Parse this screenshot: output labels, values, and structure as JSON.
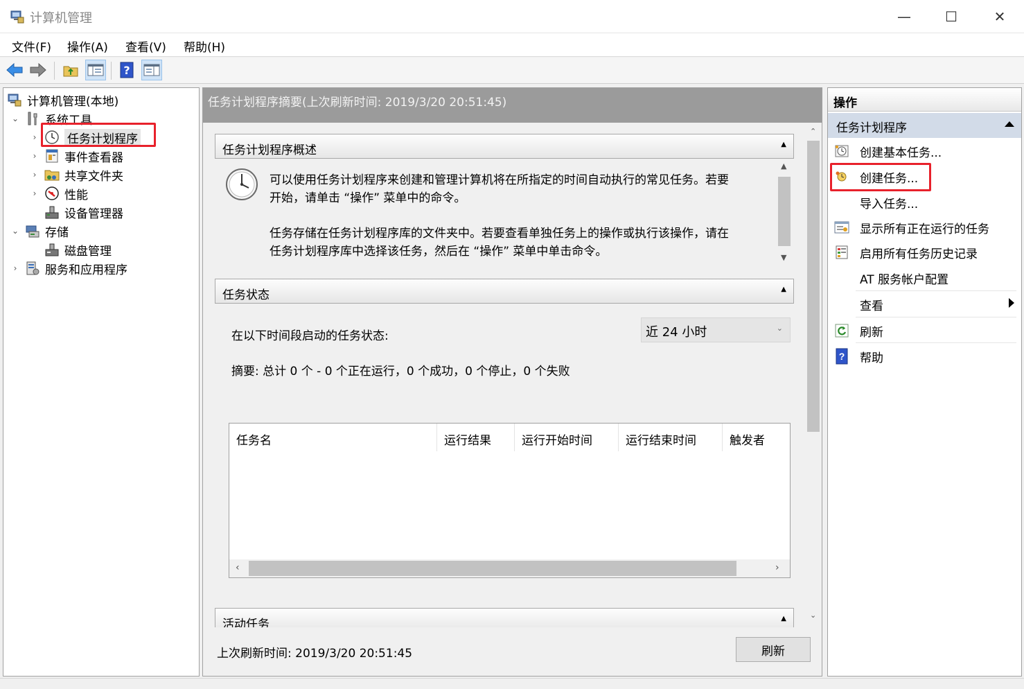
{
  "window": {
    "title": "计算机管理",
    "minimize_glyph": "—",
    "maximize_glyph": "☐",
    "close_glyph": "✕"
  },
  "menu": [
    "文件(F)",
    "操作(A)",
    "查看(V)",
    "帮助(H)"
  ],
  "toolbar": {
    "help_glyph": "?"
  },
  "tree": {
    "root": "计算机管理(本地)",
    "system_tools": "系统工具",
    "task_scheduler": "任务计划程序",
    "event_viewer": "事件查看器",
    "shared_folders": "共享文件夹",
    "performance": "性能",
    "device_manager": "设备管理器",
    "storage": "存储",
    "disk_management": "磁盘管理",
    "services_apps": "服务和应用程序"
  },
  "center": {
    "header": "任务计划程序摘要(上次刷新时间: 2019/3/20 20:51:45)",
    "overview": {
      "title": "任务计划程序概述",
      "line1": "可以使用任务计划程序来创建和管理计算机将在所指定的时间自动执行的常见任务。若要",
      "line2": "开始，请单击 “操作” 菜单中的命令。",
      "line3": "任务存储在任务计划程序库的文件夹中。若要查看单独任务上的操作或执行该操作，请在",
      "line4": "任务计划程序库中选择该任务，然后在 “操作” 菜单中单击命令。"
    },
    "status": {
      "title": "任务状态",
      "period_label": "在以下时间段启动的任务状态:",
      "period_value": "近 24 小时",
      "summary": "摘要: 总计 0 个 - 0 个正在运行，0 个成功，0 个停止，0 个失败",
      "columns": [
        "任务名",
        "运行结果",
        "运行开始时间",
        "运行结束时间",
        "触发者"
      ]
    },
    "active": {
      "title": "活动任务"
    },
    "footer": {
      "last_refresh": "上次刷新时间: 2019/3/20 20:51:45",
      "refresh_button": "刷新"
    }
  },
  "actions": {
    "header": "操作",
    "section": "任务计划程序",
    "items": {
      "create_basic": "创建基本任务...",
      "create_task": "创建任务...",
      "import": "导入任务...",
      "show_running": "显示所有正在运行的任务",
      "enable_history": "启用所有任务历史记录",
      "at_account": "AT 服务帐户配置",
      "view": "查看",
      "refresh": "刷新",
      "help": "帮助"
    }
  },
  "colors": {
    "highlight": "#e8212b",
    "header_gray": "#9b9b9b",
    "action_section": "#d2dbe8"
  }
}
